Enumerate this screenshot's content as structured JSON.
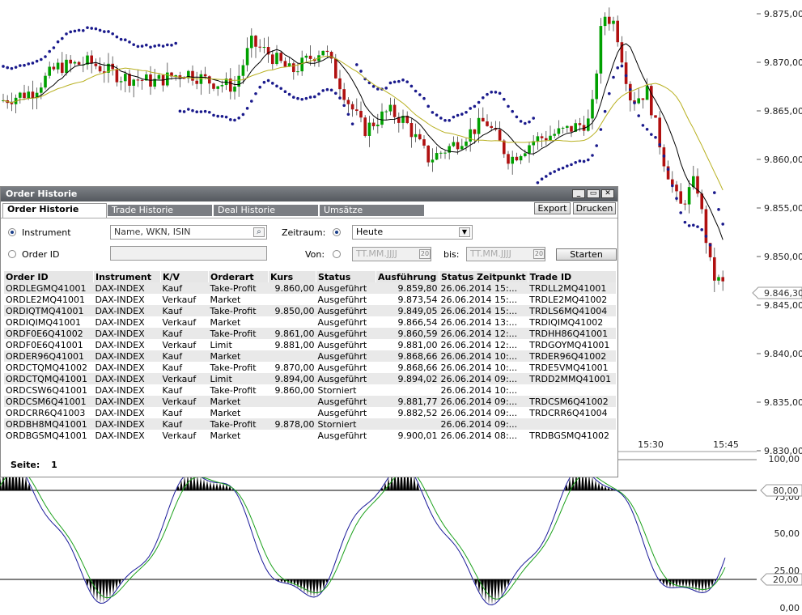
{
  "chart": {
    "price_axis": [
      "9.875,00",
      "9.870,00",
      "9.865,00",
      "9.860,00",
      "9.855,00",
      "9.850,00",
      "9.845,00",
      "9.840,00",
      "9.835,00",
      "9.830,00"
    ],
    "current_price": "9.846,30",
    "time_labels": [
      "15:30",
      "15:45"
    ],
    "osc_axis": [
      "100,00",
      "75,00",
      "50,00",
      "25,00",
      "0,00"
    ],
    "osc_levels": [
      "80,00",
      "20,00"
    ],
    "colors": {
      "up": "#00a000",
      "down": "#b01010",
      "sar": "#1a1a8c",
      "ma_fast": "#000000",
      "ma_slow": "#b8b020",
      "osc_fast": "#1a1a9a",
      "osc_slow": "#1aa01a"
    }
  },
  "dialog": {
    "title": "Order Historie",
    "tabs": [
      "Order Historie",
      "Trade Historie",
      "Deal Historie",
      "Umsätze"
    ],
    "export_label": "Export",
    "print_label": "Drucken",
    "instrument_label": "Instrument",
    "instrument_placeholder": "Name, WKN, ISIN",
    "order_id_label": "Order ID",
    "zeitraum_label": "Zeitraum:",
    "zeitraum_value": "Heute",
    "von_label": "Von:",
    "bis_label": "bis:",
    "date_placeholder": "TT.MM.JJJJ",
    "start_label": "Starten",
    "page_label": "Seite:",
    "page_value": "1",
    "columns": [
      "Order ID",
      "Instrument",
      "K/V",
      "Orderart",
      "Kurs",
      "Status",
      "Ausführung",
      "Status Zeitpunkt",
      "Trade ID"
    ],
    "rows": [
      [
        "ORDLEGMQ41001",
        "DAX-INDEX",
        "Kauf",
        "Take-Profit",
        "9.860,00",
        "Ausgeführt",
        "9.859,80",
        "26.06.2014 15:...",
        "TRDLL2MQ41001"
      ],
      [
        "ORDLE2MQ41001",
        "DAX-INDEX",
        "Verkauf",
        "Market",
        "",
        "Ausgeführt",
        "9.873,54",
        "26.06.2014 15:...",
        "TRDLE2MQ41002"
      ],
      [
        "ORDIQTMQ41001",
        "DAX-INDEX",
        "Kauf",
        "Take-Profit",
        "9.850,00",
        "Ausgeführt",
        "9.849,05",
        "26.06.2014 15:...",
        "TRDLS6MQ41004"
      ],
      [
        "ORDIQIMQ41001",
        "DAX-INDEX",
        "Verkauf",
        "Market",
        "",
        "Ausgeführt",
        "9.866,54",
        "26.06.2014 13:...",
        "TRDIQIMQ41002"
      ],
      [
        "ORDF0E6Q41002",
        "DAX-INDEX",
        "Kauf",
        "Take-Profit",
        "9.861,00",
        "Ausgeführt",
        "9.860,59",
        "26.06.2014 12:...",
        "TRDHH86Q41001"
      ],
      [
        "ORDF0E6Q41001",
        "DAX-INDEX",
        "Verkauf",
        "Limit",
        "9.881,00",
        "Ausgeführt",
        "9.881,00",
        "26.06.2014 12:...",
        "TRDGOYMQ41001"
      ],
      [
        "ORDER96Q41001",
        "DAX-INDEX",
        "Kauf",
        "Market",
        "",
        "Ausgeführt",
        "9.868,66",
        "26.06.2014 10:...",
        "TRDER96Q41002"
      ],
      [
        "ORDCTQMQ41002",
        "DAX-INDEX",
        "Kauf",
        "Take-Profit",
        "9.870,00",
        "Ausgeführt",
        "9.868,66",
        "26.06.2014 10:...",
        "TRDE5VMQ41001"
      ],
      [
        "ORDCTQMQ41001",
        "DAX-INDEX",
        "Verkauf",
        "Limit",
        "9.894,00",
        "Ausgeführt",
        "9.894,02",
        "26.06.2014 09:...",
        "TRDD2MMQ41001"
      ],
      [
        "ORDCSW6Q41001",
        "DAX-INDEX",
        "Kauf",
        "Take-Profit",
        "9.860,00",
        "Storniert",
        "",
        "26.06.2014 10:...",
        ""
      ],
      [
        "ORDCSM6Q41001",
        "DAX-INDEX",
        "Verkauf",
        "Market",
        "",
        "Ausgeführt",
        "9.881,77",
        "26.06.2014 09:...",
        "TRDCSM6Q41002"
      ],
      [
        "ORDCRR6Q41003",
        "DAX-INDEX",
        "Kauf",
        "Market",
        "",
        "Ausgeführt",
        "9.882,52",
        "26.06.2014 09:...",
        "TRDCRR6Q41004"
      ],
      [
        "ORDBH8MQ41001",
        "DAX-INDEX",
        "Kauf",
        "Take-Profit",
        "9.878,00",
        "Storniert",
        "",
        "26.06.2014 09:...",
        ""
      ],
      [
        "ORDBGSMQ41001",
        "DAX-INDEX",
        "Verkauf",
        "Market",
        "",
        "Ausgeführt",
        "9.900,01",
        "26.06.2014 08:...",
        "TRDBGSMQ41002"
      ]
    ]
  }
}
